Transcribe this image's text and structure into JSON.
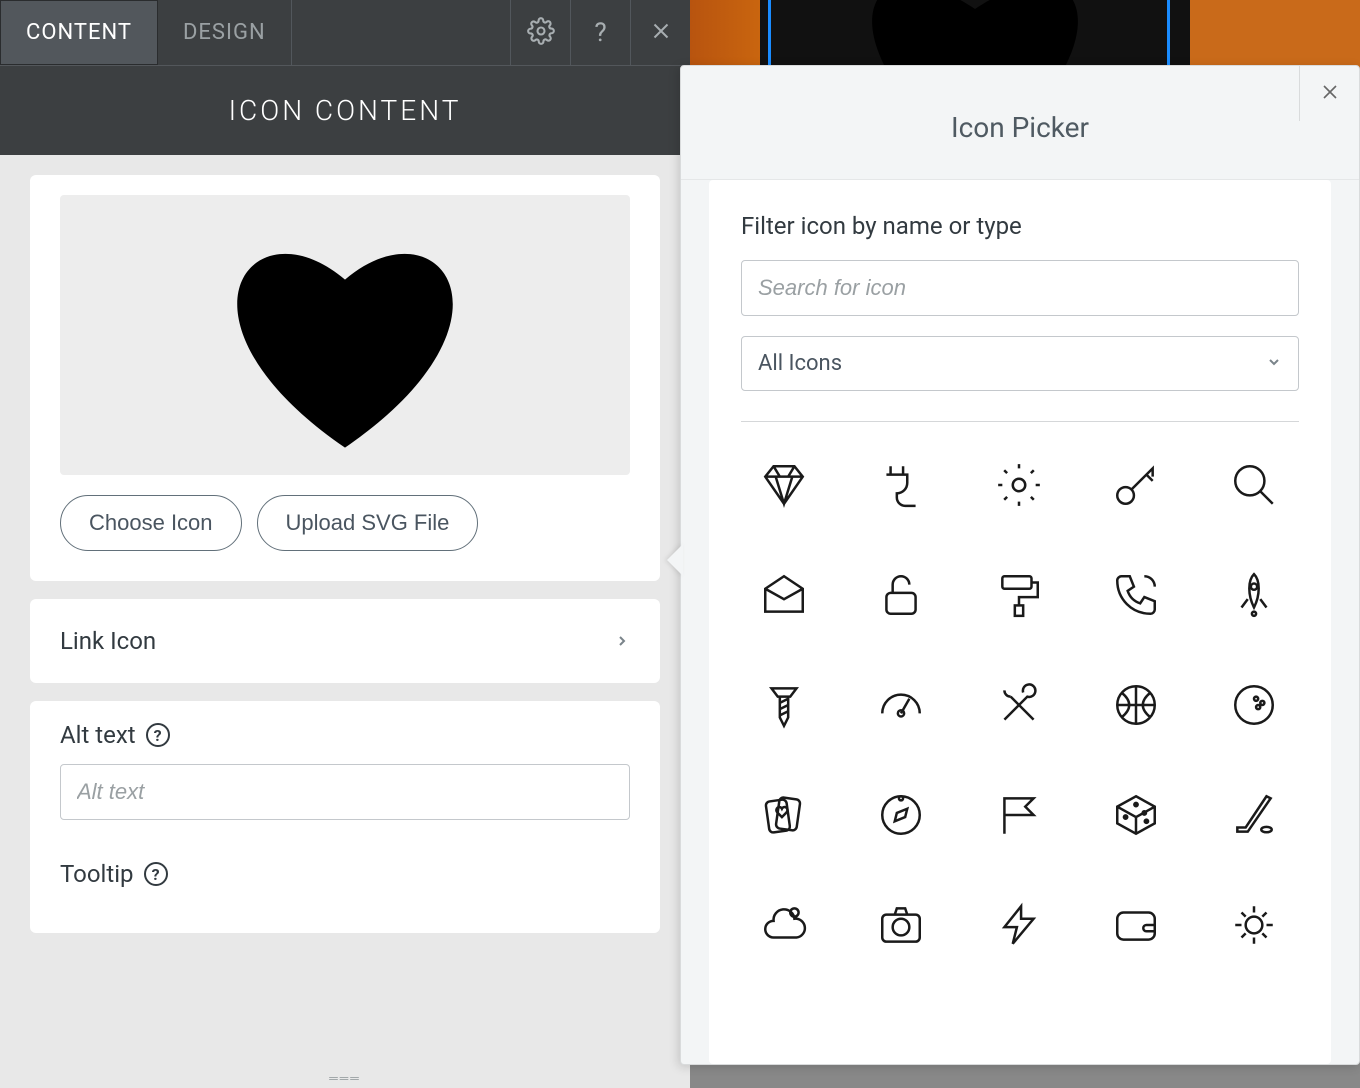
{
  "tabs": {
    "content": "CONTENT",
    "design": "DESIGN"
  },
  "section_title": "ICON CONTENT",
  "buttons": {
    "choose": "Choose Icon",
    "upload": "Upload SVG File"
  },
  "link_row": "Link Icon",
  "alt": {
    "label": "Alt text",
    "placeholder": "Alt text"
  },
  "tooltip": {
    "label": "Tooltip"
  },
  "picker": {
    "title": "Icon Picker",
    "filter_label": "Filter icon by name or type",
    "search_placeholder": "Search for icon",
    "select_value": "All Icons",
    "icons": [
      "diamond",
      "plug",
      "gear",
      "key",
      "magnifier",
      "envelope",
      "lock-open",
      "paint-roller",
      "phone",
      "rocket",
      "screw",
      "gauge",
      "tools",
      "basketball",
      "bowling",
      "cards",
      "compass",
      "flag",
      "dice",
      "hockey",
      "cloud",
      "camera",
      "lightning",
      "wallet",
      "gear2"
    ]
  }
}
